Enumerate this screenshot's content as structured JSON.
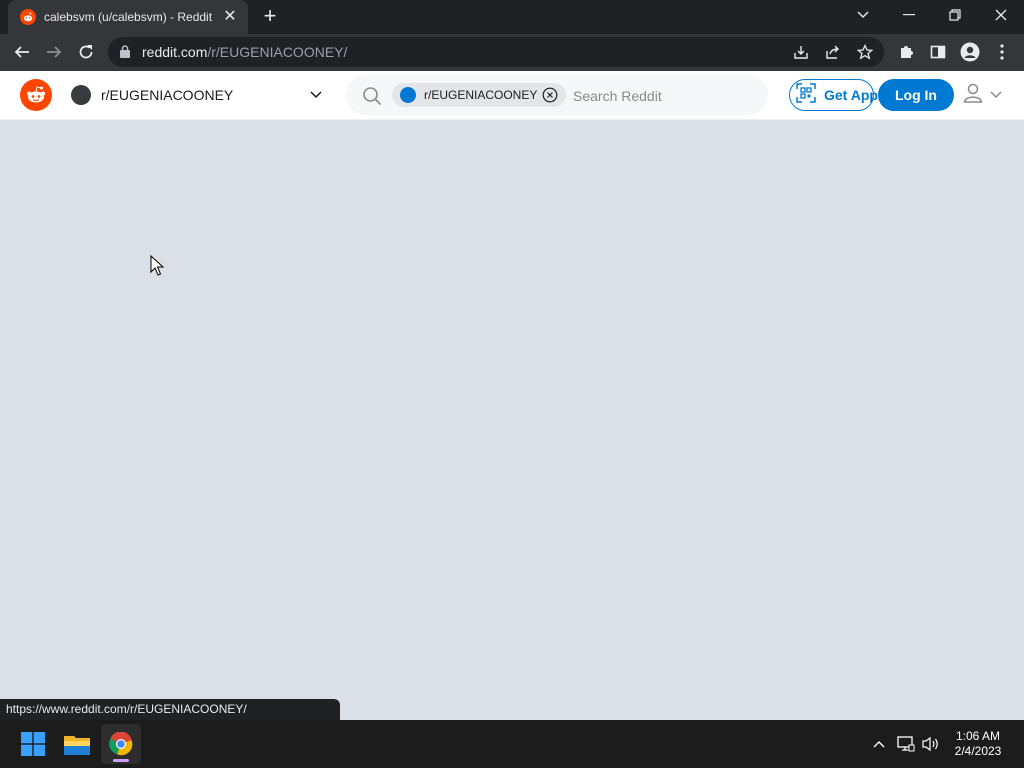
{
  "browser": {
    "tab": {
      "title": "calebsvm (u/calebsvm) - Reddit",
      "close": "✕"
    },
    "newtab": "+",
    "omnibox": {
      "host": "reddit.com",
      "path": "/r/EUGENIACOONEY/"
    }
  },
  "reddit": {
    "community": {
      "name": "r/EUGENIACOONEY"
    },
    "search": {
      "chip_label": "r/EUGENIACOONEY",
      "placeholder": "Search Reddit"
    },
    "get_app_label": "Get App",
    "login_label": "Log In",
    "colors": {
      "brand": "#ff4500",
      "accent": "#0079d3",
      "background": "#dae0e6"
    }
  },
  "status_url": "https://www.reddit.com/r/EUGENIACOONEY/",
  "taskbar": {
    "time": "1:06 AM",
    "date": "2/4/2023"
  }
}
